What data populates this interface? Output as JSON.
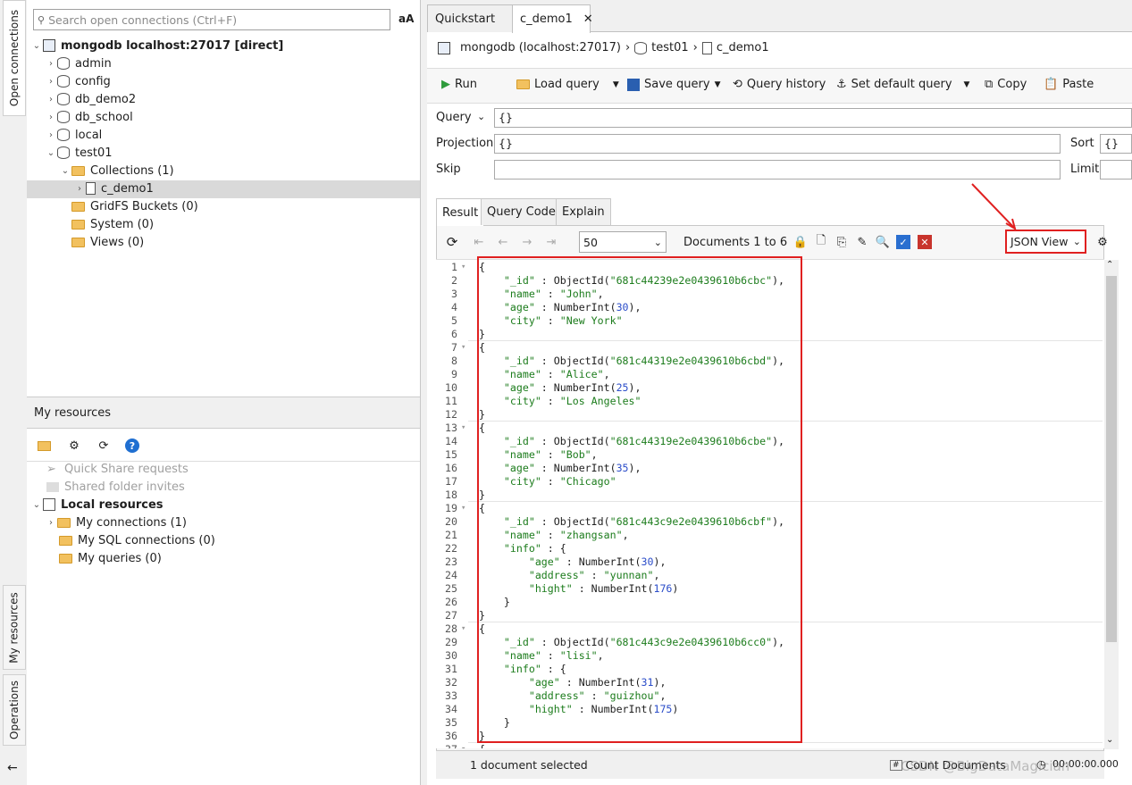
{
  "sidebar_vtabs": {
    "open_connections": "Open connections",
    "my_resources": "My resources",
    "operations": "Operations"
  },
  "search": {
    "placeholder": "Search open connections (Ctrl+F)",
    "font_toggle": "aA"
  },
  "tree": {
    "server": "mongodb localhost:27017 [direct]",
    "dbs": [
      "admin",
      "config",
      "db_demo2",
      "db_school",
      "local",
      "test01"
    ],
    "collections": "Collections (1)",
    "collection_item": "c_demo1",
    "gridfs": "GridFS Buckets (0)",
    "system": "System (0)",
    "views": "Views (0)"
  },
  "resources": {
    "title": "My resources",
    "quick_share": "Quick Share requests",
    "shared_folder": "Shared folder invites",
    "local": "Local resources",
    "my_connections": "My connections (1)",
    "my_sql": "My SQL connections (0)",
    "my_queries": "My queries (0)"
  },
  "tabs": {
    "quickstart": "Quickstart",
    "c_demo1": "c_demo1"
  },
  "breadcrumb": {
    "server": "mongodb (localhost:27017)",
    "db": "test01",
    "coll": "c_demo1"
  },
  "toolbar": {
    "run": "Run",
    "load": "Load query",
    "save": "Save query",
    "history": "Query history",
    "default": "Set default query",
    "copy": "Copy",
    "paste": "Paste"
  },
  "query": {
    "query_label": "Query",
    "query_value": "{}",
    "projection_label": "Projection",
    "projection_value": "{}",
    "sort_label": "Sort",
    "sort_value": "{}",
    "skip_label": "Skip",
    "skip_value": "",
    "limit_label": "Limit",
    "limit_value": ""
  },
  "result_tabs": {
    "result": "Result",
    "code": "Query Code",
    "explain": "Explain"
  },
  "results": {
    "page_size": "50",
    "docs": "Documents 1 to 6",
    "view": "JSON View"
  },
  "status": {
    "selected": "1 document selected",
    "count": "Count Documents",
    "time": "00:00:00.000",
    "watermark": "CSDN @BigDataMagician"
  },
  "code_lines": [
    "{",
    "    \"_id\" : ObjectId(\"681c44239e2e0439610b6cbc\"),",
    "    \"name\" : \"John\",",
    "    \"age\" : NumberInt(30),",
    "    \"city\" : \"New York\"",
    "}",
    "{",
    "    \"_id\" : ObjectId(\"681c44319e2e0439610b6cbd\"),",
    "    \"name\" : \"Alice\",",
    "    \"age\" : NumberInt(25),",
    "    \"city\" : \"Los Angeles\"",
    "}",
    "{",
    "    \"_id\" : ObjectId(\"681c44319e2e0439610b6cbe\"),",
    "    \"name\" : \"Bob\",",
    "    \"age\" : NumberInt(35),",
    "    \"city\" : \"Chicago\"",
    "}",
    "{",
    "    \"_id\" : ObjectId(\"681c443c9e2e0439610b6cbf\"),",
    "    \"name\" : \"zhangsan\",",
    "    \"info\" : {",
    "        \"age\" : NumberInt(30),",
    "        \"address\" : \"yunnan\",",
    "        \"hight\" : NumberInt(176)",
    "    }",
    "}",
    "{",
    "    \"_id\" : ObjectId(\"681c443c9e2e0439610b6cc0\"),",
    "    \"name\" : \"lisi\",",
    "    \"info\" : {",
    "        \"age\" : NumberInt(31),",
    "        \"address\" : \"guizhou\",",
    "        \"hight\" : NumberInt(175)",
    "    }",
    "}",
    "{"
  ],
  "colors": {
    "highlight_red": "#e02020",
    "string_green": "#1c7c1c",
    "number_blue": "#2b4dc9"
  }
}
